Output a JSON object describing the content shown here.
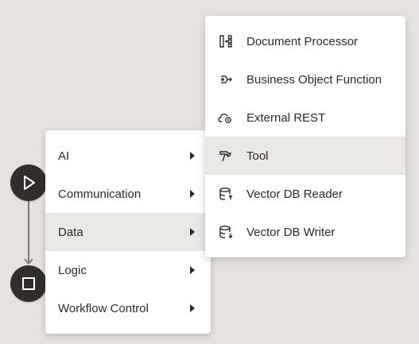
{
  "canvas": {
    "background_color": "#e6e3df",
    "node_color": "#312d2a",
    "connector_color": "#7d7872",
    "nodes": [
      {
        "name": "start-node",
        "icon": "play-icon"
      },
      {
        "name": "end-node",
        "icon": "stop-icon"
      }
    ]
  },
  "primary_menu": {
    "items": [
      {
        "label": "AI",
        "has_submenu": true,
        "icon": "caret-right-icon"
      },
      {
        "label": "Communication",
        "has_submenu": true,
        "icon": "caret-right-icon"
      },
      {
        "label": "Data",
        "has_submenu": true,
        "highlighted": true,
        "icon": "caret-right-icon"
      },
      {
        "label": "Logic",
        "has_submenu": true,
        "icon": "caret-right-icon"
      },
      {
        "label": "Workflow Control",
        "has_submenu": true,
        "icon": "caret-right-icon"
      }
    ],
    "highlight_color": "#eae8e5"
  },
  "data_submenu": {
    "items": [
      {
        "label": "Document Processor",
        "icon": "document-processor-icon"
      },
      {
        "label": "Business Object Function",
        "icon": "business-object-function-icon"
      },
      {
        "label": "External REST",
        "icon": "external-rest-icon"
      },
      {
        "label": "Tool",
        "icon": "tool-icon",
        "highlighted": true
      },
      {
        "label": "Vector DB Reader",
        "icon": "vector-db-reader-icon"
      },
      {
        "label": "Vector DB Writer",
        "icon": "vector-db-writer-icon"
      }
    ]
  }
}
